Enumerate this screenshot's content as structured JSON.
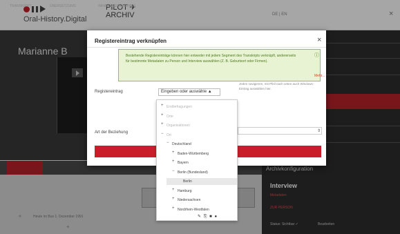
{
  "app": {
    "brand": "Oral-History.Digital",
    "pilot_line1": "PILOT ✈",
    "pilot_line2": "ARCHIV",
    "language": "DE | EN",
    "close_glyph": "×"
  },
  "interview": {
    "name": "Marianne B"
  },
  "tabs": [
    "TRANSKRIPT",
    "ÜBERSETZUNG",
    "INHALTSVERZEICHNIS"
  ],
  "segment": {
    "label": "Heute im Bus 1. Dezember 1991",
    "plus": "+"
  },
  "right_panel": {
    "archiv_config": "Archivkonfiguration",
    "interview_heading": "Interview",
    "field1": "Metadaten",
    "field2": "ZUR PERSON",
    "field3": "Status: Sichtbar ✓",
    "field4": "Bearbeiten"
  },
  "modal": {
    "title": "Registereintrag verknüpfen",
    "close_glyph": "×",
    "info_text": "Bestehende Registereinträge können hier entweder mit jedem Segment des Transkripts verknüpft, andererseits für bestimmte Metadaten zu Person und Interview auswählen (Z. B. Geburtsort oder Firmen).",
    "info_icon": "ⓘ",
    "info_more": "Mehr...",
    "register_label": "Registereintrag",
    "select_value": "Eingeben oder auswähle ▲",
    "hint_text": "Jeden navigieren, mit Pfeil nach unten auch Windows-Eintrag auswählen hier.",
    "relation_label": "Art der Beziehung",
    "relation_arrow": "⇕"
  },
  "dropdown": {
    "items": [
      {
        "sign": "+",
        "label": "Erstbefragungen",
        "dim": true
      },
      {
        "sign": "+",
        "label": "Orte",
        "dim": true
      },
      {
        "sign": "+",
        "label": "Organisationen",
        "dim": true
      },
      {
        "sign": "−",
        "label": "Ort",
        "dim": true
      },
      {
        "sign": "−",
        "label": "Deutschland",
        "dim": false
      },
      {
        "sign": "+",
        "label": "Baden-Württemberg",
        "dim": false
      },
      {
        "sign": "+",
        "label": "Bayern",
        "dim": false
      },
      {
        "sign": "−",
        "label": "Berlin (Bundesland)",
        "dim": false
      },
      {
        "sign": "",
        "label": "Berlin",
        "dim": false
      },
      {
        "sign": "+",
        "label": "Hamburg",
        "dim": false
      },
      {
        "sign": "+",
        "label": "Niedersachsen",
        "dim": false
      },
      {
        "sign": "+",
        "label": "Nordrhein-Westfalen",
        "dim": false
      }
    ],
    "highlighted_index": 8
  },
  "colors": {
    "accent_red": "#c91e29",
    "info_green_bg": "#e7f3d3",
    "info_green_border": "#8bc34a"
  }
}
